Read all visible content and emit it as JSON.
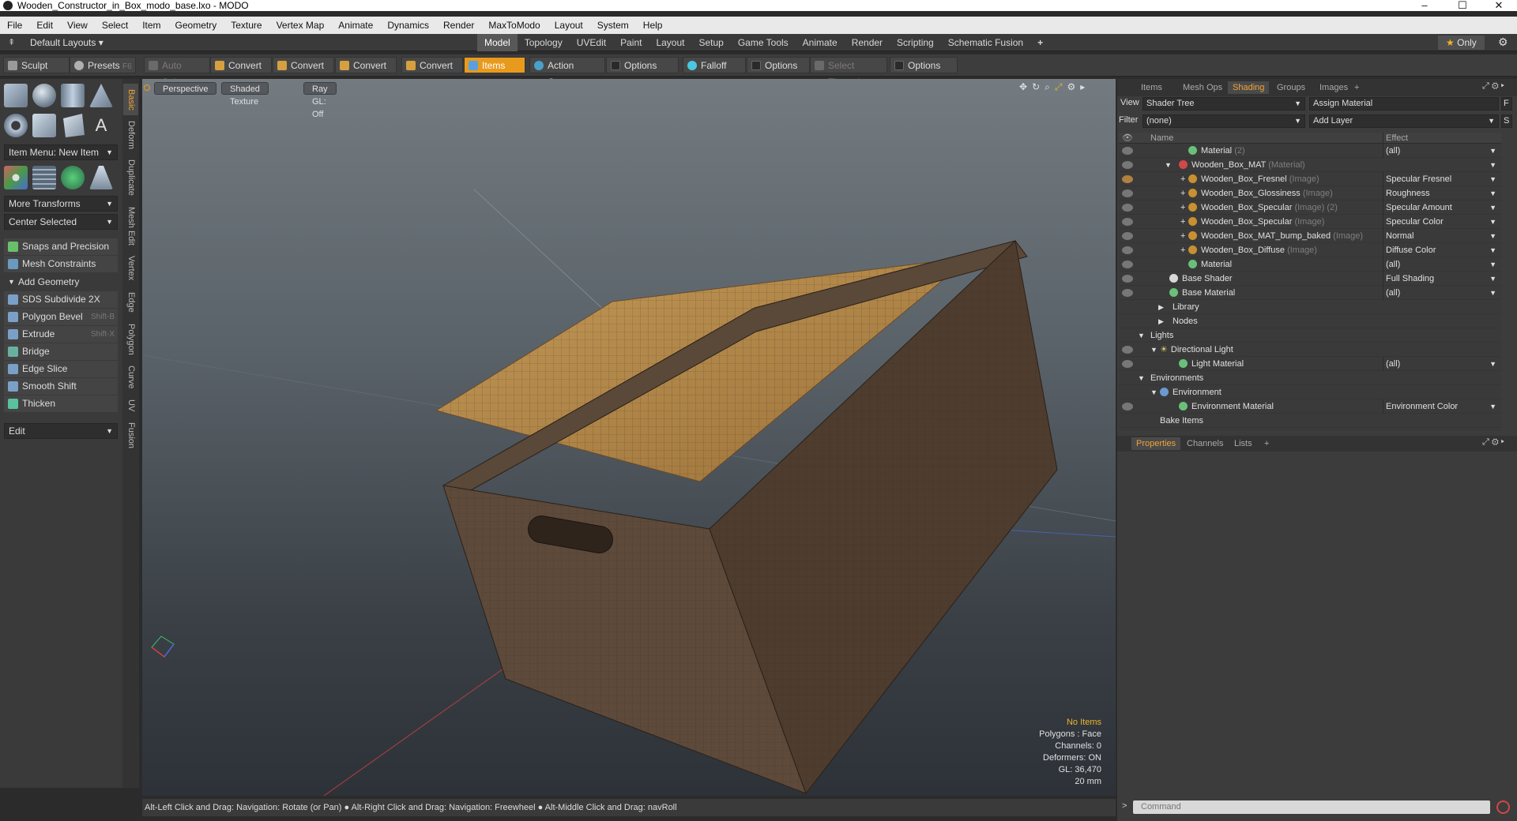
{
  "window": {
    "title": "Wooden_Constructor_in_Box_modo_base.lxo - MODO"
  },
  "menu": [
    "File",
    "Edit",
    "View",
    "Select",
    "Item",
    "Geometry",
    "Texture",
    "Vertex Map",
    "Animate",
    "Dynamics",
    "Render",
    "MaxToModo",
    "Layout",
    "System",
    "Help"
  ],
  "layouts": {
    "label": "Default Layouts",
    "only": "Only"
  },
  "layout_tabs": [
    "Model",
    "Topology",
    "UVEdit",
    "Paint",
    "Layout",
    "Setup",
    "Game Tools",
    "Animate",
    "Render",
    "Scripting",
    "Schematic Fusion"
  ],
  "toolbar": {
    "sculpt": "Sculpt",
    "presets": "Presets",
    "presets_key": "F6",
    "auto_select": "Auto Select",
    "convert": "Convert",
    "items": "Items",
    "action_center": "Action Center",
    "options": "Options",
    "falloff": "Falloff",
    "select_through": "Select Through"
  },
  "left_panel": {
    "vtabs": [
      "Basic",
      "Deform",
      "Duplicate",
      "Mesh Edit",
      "Vertex",
      "Edge",
      "Polygon",
      "Curve",
      "UV",
      "Fusion"
    ],
    "item_menu": "Item Menu: New Item",
    "more_transforms": "More Transforms",
    "center_selected": "Center Selected",
    "snaps": "Snaps and Precision",
    "mesh_constraints": "Mesh Constraints",
    "add_geometry": "Add Geometry",
    "tools": [
      {
        "label": "SDS Subdivide 2X",
        "shortcut": ""
      },
      {
        "label": "Polygon Bevel",
        "shortcut": "Shift-B"
      },
      {
        "label": "Extrude",
        "shortcut": "Shift-X"
      },
      {
        "label": "Bridge",
        "shortcut": ""
      },
      {
        "label": "Edge Slice",
        "shortcut": ""
      },
      {
        "label": "Smooth Shift",
        "shortcut": ""
      },
      {
        "label": "Thicken",
        "shortcut": ""
      }
    ],
    "edit": "Edit"
  },
  "viewport": {
    "perspective": "Perspective",
    "shading": "Shaded Texture",
    "raygl": "Ray GL: Off",
    "info": {
      "no_items": "No Items",
      "polygons": "Polygons : Face",
      "channels": "Channels: 0",
      "deformers": "Deformers: ON",
      "gl": "GL: 36,470",
      "scale": "20 mm"
    }
  },
  "status_bar": "Alt-Left Click and Drag: Navigation: Rotate (or Pan) ● Alt-Right Click and Drag: Navigation: Freewheel ● Alt-Middle Click and Drag: navRoll",
  "right_panel": {
    "tabs": [
      "Items",
      "Mesh Ops",
      "Shading",
      "Groups",
      "Images"
    ],
    "view_label": "View",
    "view_value": "Shader Tree",
    "assign_material": "Assign Material",
    "filter_label": "Filter",
    "filter_value": "(none)",
    "add_layer": "Add Layer",
    "col_name": "Name",
    "col_effect": "Effect",
    "rows": [
      {
        "name": "Material",
        "type": "(2)",
        "effect": "(all)"
      },
      {
        "name": "Wooden_Box_MAT",
        "type": "(Material)",
        "effect": ""
      },
      {
        "name": "Wooden_Box_Fresnel",
        "type": "(Image)",
        "effect": "Specular Fresnel"
      },
      {
        "name": "Wooden_Box_Glossiness",
        "type": "(Image)",
        "effect": "Roughness"
      },
      {
        "name": "Wooden_Box_Specular",
        "type": "(Image) (2)",
        "effect": "Specular Amount"
      },
      {
        "name": "Wooden_Box_Specular",
        "type": "(Image)",
        "effect": "Specular Color"
      },
      {
        "name": "Wooden_Box_MAT_bump_baked",
        "type": "(Image)",
        "effect": "Normal"
      },
      {
        "name": "Wooden_Box_Diffuse",
        "type": "(Image)",
        "effect": "Diffuse Color"
      },
      {
        "name": "Material",
        "type": "",
        "effect": "(all)"
      },
      {
        "name": "Base Shader",
        "type": "",
        "effect": "Full Shading"
      },
      {
        "name": "Base Material",
        "type": "",
        "effect": "(all)"
      },
      {
        "name": "Library",
        "type": "",
        "effect": ""
      },
      {
        "name": "Nodes",
        "type": "",
        "effect": ""
      },
      {
        "name": "Lights",
        "type": "",
        "effect": ""
      },
      {
        "name": "Directional Light",
        "type": "",
        "effect": ""
      },
      {
        "name": "Light Material",
        "type": "",
        "effect": "(all)"
      },
      {
        "name": "Environments",
        "type": "",
        "effect": ""
      },
      {
        "name": "Environment",
        "type": "",
        "effect": ""
      },
      {
        "name": "Environment Material",
        "type": "",
        "effect": "Environment Color"
      },
      {
        "name": "Bake Items",
        "type": "",
        "effect": ""
      }
    ],
    "bottom_tabs": [
      "Properties",
      "Channels",
      "Lists"
    ],
    "command_placeholder": "Command"
  },
  "colors": {
    "accent": "#f0a33a",
    "items_active": "#e89a1d",
    "wood_light": "#c99a4e",
    "wood_dark": "#5a4636"
  }
}
